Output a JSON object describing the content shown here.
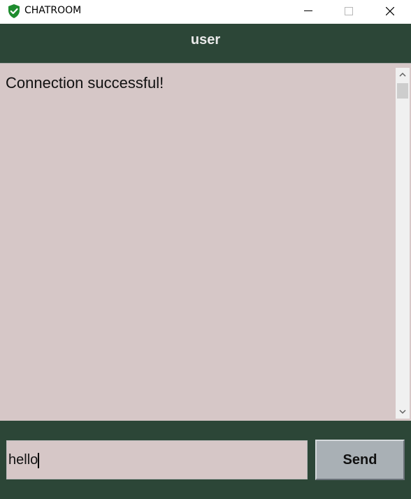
{
  "window": {
    "title": "CHATROOM"
  },
  "header": {
    "username": "user"
  },
  "messages": [
    {
      "text": "Connection successful!"
    }
  ],
  "composer": {
    "value": "hello",
    "send_label": "Send"
  },
  "colors": {
    "panel_dark_green": "#2c4637",
    "message_bg": "#d6c7c7",
    "send_button_bg": "#a9b0b5",
    "app_icon_green": "#1e8c2e"
  },
  "icons": {
    "app": "shield-check-icon",
    "minimize": "minimize-icon",
    "maximize": "maximize-icon",
    "close": "close-icon"
  }
}
